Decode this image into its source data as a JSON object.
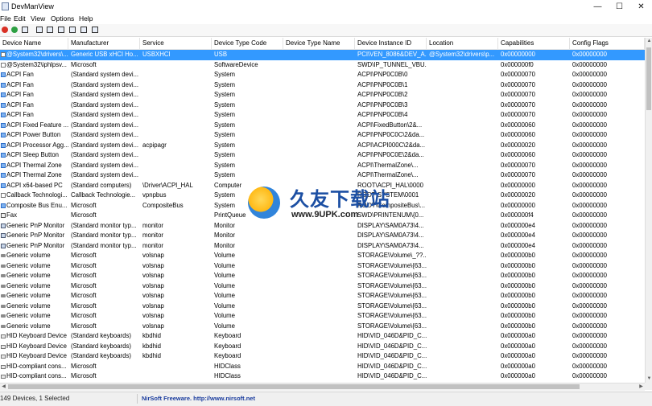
{
  "window": {
    "title": "DevManView",
    "minimize": "—",
    "maximize": "☐",
    "close": "✕"
  },
  "menu": [
    "File",
    "Edit",
    "View",
    "Options",
    "Help"
  ],
  "columns": [
    "Device Name",
    "Manufacturer",
    "Service",
    "Device Type Code",
    "Device Type Name",
    "Device Instance ID",
    "Location",
    "Capabilities",
    "Config Flags"
  ],
  "rows": [
    {
      "icon": "doc",
      "cells": [
        "@System32\\drivers\\...",
        "Generic USB xHCI Ho...",
        "USBXHCI",
        "USB",
        "",
        "PCI\\VEN_8086&DEV_A...",
        "@System32\\drivers\\p...",
        "0x00000000",
        "0x00000000"
      ]
    },
    {
      "icon": "doc",
      "cells": [
        "@System32\\iphlpsv...",
        "Microsoft",
        "",
        "SoftwareDevice",
        "",
        "SWD\\IP_TUNNEL_VBU...",
        "",
        "0x000000f0",
        "0x00000000"
      ]
    },
    {
      "icon": "fan",
      "cells": [
        "ACPI Fan",
        "(Standard system devi...",
        "",
        "System",
        "",
        "ACPI\\PNP0C0B\\0",
        "",
        "0x00000070",
        "0x00000000"
      ]
    },
    {
      "icon": "fan",
      "cells": [
        "ACPI Fan",
        "(Standard system devi...",
        "",
        "System",
        "",
        "ACPI\\PNP0C0B\\1",
        "",
        "0x00000070",
        "0x00000000"
      ]
    },
    {
      "icon": "fan",
      "cells": [
        "ACPI Fan",
        "(Standard system devi...",
        "",
        "System",
        "",
        "ACPI\\PNP0C0B\\2",
        "",
        "0x00000070",
        "0x00000000"
      ]
    },
    {
      "icon": "fan",
      "cells": [
        "ACPI Fan",
        "(Standard system devi...",
        "",
        "System",
        "",
        "ACPI\\PNP0C0B\\3",
        "",
        "0x00000070",
        "0x00000000"
      ]
    },
    {
      "icon": "fan",
      "cells": [
        "ACPI Fan",
        "(Standard system devi...",
        "",
        "System",
        "",
        "ACPI\\PNP0C0B\\4",
        "",
        "0x00000070",
        "0x00000000"
      ]
    },
    {
      "icon": "fan",
      "cells": [
        "ACPI Fixed Feature ...",
        "(Standard system devi...",
        "",
        "System",
        "",
        "ACPI\\FixedButton\\2&...",
        "",
        "0x00000060",
        "0x00000000"
      ]
    },
    {
      "icon": "fan",
      "cells": [
        "ACPI Power Button",
        "(Standard system devi...",
        "",
        "System",
        "",
        "ACPI\\PNP0C0C\\2&da...",
        "",
        "0x00000060",
        "0x00000000"
      ]
    },
    {
      "icon": "fan",
      "cells": [
        "ACPI Processor Agg...",
        "(Standard system devi...",
        "acpipagr",
        "System",
        "",
        "ACPI\\ACPI000C\\2&da...",
        "",
        "0x00000020",
        "0x00000000"
      ]
    },
    {
      "icon": "fan",
      "cells": [
        "ACPI Sleep Button",
        "(Standard system devi...",
        "",
        "System",
        "",
        "ACPI\\PNP0C0E\\2&da...",
        "",
        "0x00000060",
        "0x00000000"
      ]
    },
    {
      "icon": "fan",
      "cells": [
        "ACPI Thermal Zone",
        "(Standard system devi...",
        "",
        "System",
        "",
        "ACPI\\ThermalZone\\...",
        "",
        "0x00000070",
        "0x00000000"
      ]
    },
    {
      "icon": "fan",
      "cells": [
        "ACPI Thermal Zone",
        "(Standard system devi...",
        "",
        "System",
        "",
        "ACPI\\ThermalZone\\...",
        "",
        "0x00000070",
        "0x00000000"
      ]
    },
    {
      "icon": "fan",
      "cells": [
        "ACPI x64-based PC",
        "(Standard computers)",
        "\\Driver\\ACPI_HAL",
        "Computer",
        "",
        "ROOT\\ACPI_HAL\\0000",
        "",
        "0x00000000",
        "0x00000000"
      ]
    },
    {
      "icon": "doc",
      "cells": [
        "Callback Technologi...",
        "Callback Technologie...",
        "vpnpbus",
        "System",
        "",
        "ROOT\\SYSTEM\\0001",
        "",
        "0x00000020",
        "0x00000000"
      ]
    },
    {
      "icon": "fan",
      "cells": [
        "Composite Bus Enu...",
        "Microsoft",
        "CompositeBus",
        "System",
        "",
        "ROOT\\CompositeBus\\...",
        "",
        "0x00000000",
        "0x00000000"
      ]
    },
    {
      "icon": "fax",
      "cells": [
        "Fax",
        "Microsoft",
        "",
        "PrintQueue",
        "",
        "SWD\\PRINTENUM\\{0...",
        "",
        "0x000000f4",
        "0x00000000"
      ]
    },
    {
      "icon": "monitor",
      "cells": [
        "Generic PnP Monitor",
        "(Standard monitor typ...",
        "monitor",
        "Monitor",
        "",
        "DISPLAY\\SAM0A73\\4...",
        "",
        "0x000000e4",
        "0x00000000"
      ]
    },
    {
      "icon": "monitor",
      "cells": [
        "Generic PnP Monitor",
        "(Standard monitor typ...",
        "monitor",
        "Monitor",
        "",
        "DISPLAY\\SAM0A73\\4...",
        "",
        "0x000000e4",
        "0x00000000"
      ]
    },
    {
      "icon": "monitor",
      "cells": [
        "Generic PnP Monitor",
        "(Standard monitor typ...",
        "monitor",
        "Monitor",
        "",
        "DISPLAY\\SAM0A73\\4...",
        "",
        "0x000000e4",
        "0x00000000"
      ]
    },
    {
      "icon": "volume",
      "cells": [
        "Generic volume",
        "Microsoft",
        "volsnap",
        "Volume",
        "",
        "STORAGE\\Volume\\_??...",
        "",
        "0x000000b0",
        "0x00000000"
      ]
    },
    {
      "icon": "volume",
      "cells": [
        "Generic volume",
        "Microsoft",
        "volsnap",
        "Volume",
        "",
        "STORAGE\\Volume\\{63...",
        "",
        "0x000000b0",
        "0x00000000"
      ]
    },
    {
      "icon": "volume",
      "cells": [
        "Generic volume",
        "Microsoft",
        "volsnap",
        "Volume",
        "",
        "STORAGE\\Volume\\{63...",
        "",
        "0x000000b0",
        "0x00000000"
      ]
    },
    {
      "icon": "volume",
      "cells": [
        "Generic volume",
        "Microsoft",
        "volsnap",
        "Volume",
        "",
        "STORAGE\\Volume\\{63...",
        "",
        "0x000000b0",
        "0x00000000"
      ]
    },
    {
      "icon": "volume",
      "cells": [
        "Generic volume",
        "Microsoft",
        "volsnap",
        "Volume",
        "",
        "STORAGE\\Volume\\{63...",
        "",
        "0x000000b0",
        "0x00000000"
      ]
    },
    {
      "icon": "volume",
      "cells": [
        "Generic volume",
        "Microsoft",
        "volsnap",
        "Volume",
        "",
        "STORAGE\\Volume\\{63...",
        "",
        "0x000000b0",
        "0x00000000"
      ]
    },
    {
      "icon": "volume",
      "cells": [
        "Generic volume",
        "Microsoft",
        "volsnap",
        "Volume",
        "",
        "STORAGE\\Volume\\{63...",
        "",
        "0x000000b0",
        "0x00000000"
      ]
    },
    {
      "icon": "volume",
      "cells": [
        "Generic volume",
        "Microsoft",
        "volsnap",
        "Volume",
        "",
        "STORAGE\\Volume\\{63...",
        "",
        "0x000000b0",
        "0x00000000"
      ]
    },
    {
      "icon": "keyboard",
      "cells": [
        "HID Keyboard Device",
        "(Standard keyboards)",
        "kbdhid",
        "Keyboard",
        "",
        "HID\\VID_046D&PID_C...",
        "",
        "0x000000a0",
        "0x00000000"
      ]
    },
    {
      "icon": "keyboard",
      "cells": [
        "HID Keyboard Device",
        "(Standard keyboards)",
        "kbdhid",
        "Keyboard",
        "",
        "HID\\VID_046D&PID_C...",
        "",
        "0x000000a0",
        "0x00000000"
      ]
    },
    {
      "icon": "keyboard",
      "cells": [
        "HID Keyboard Device",
        "(Standard keyboards)",
        "kbdhid",
        "Keyboard",
        "",
        "HID\\VID_046D&PID_C...",
        "",
        "0x000000a0",
        "0x00000000"
      ]
    },
    {
      "icon": "keyboard",
      "cells": [
        "HID-compliant cons...",
        "Microsoft",
        "",
        "HIDClass",
        "",
        "HID\\VID_046D&PID_C...",
        "",
        "0x000000a0",
        "0x00000000"
      ]
    },
    {
      "icon": "keyboard",
      "cells": [
        "HID-compliant cons...",
        "Microsoft",
        "",
        "HIDClass",
        "",
        "HID\\VID_046D&PID_C...",
        "",
        "0x000000a0",
        "0x00000000"
      ]
    }
  ],
  "selected_row": 0,
  "status": {
    "count": "149 Devices, 1 Selected",
    "link": "NirSoft Freeware.  http://www.nirsoft.net"
  },
  "watermark": {
    "cn": "久友下载站",
    "url": "www.9UPK.com"
  },
  "colors": {
    "selection": "#3399ff",
    "link": "#1a3c9e"
  }
}
